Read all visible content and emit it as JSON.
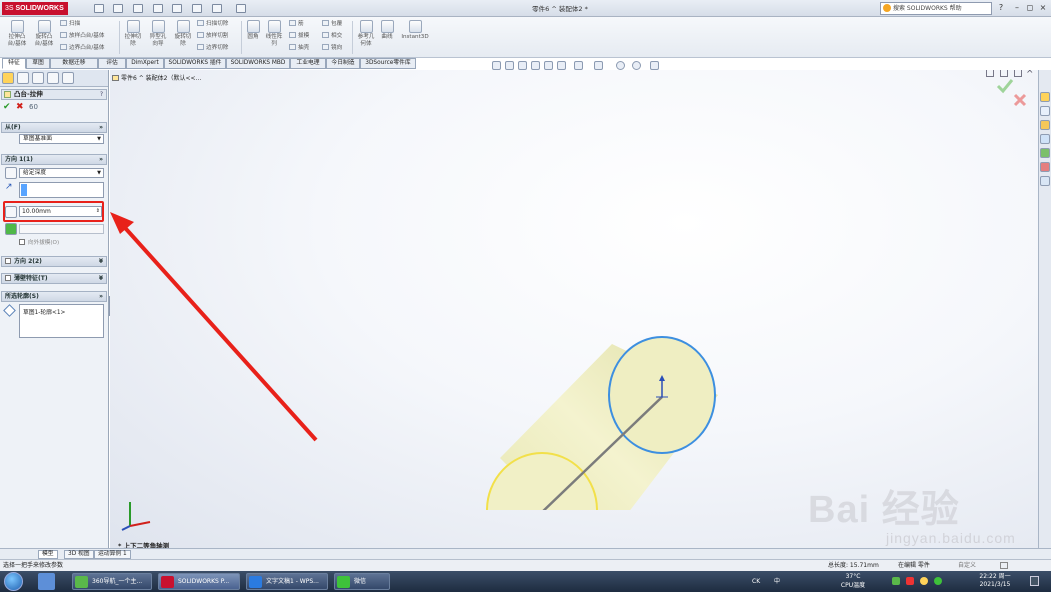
{
  "app": {
    "logo_text": "SOLIDWORKS",
    "logo_prefix": "3S",
    "window_title": "零件6 ^ 装配体2 *",
    "help_search_placeholder": "搜索 SOLIDWORKS 帮助",
    "help_menu": "?",
    "win_minimize": "–",
    "win_restore": "◻",
    "win_close": "×"
  },
  "ribbon": {
    "extrude_boss": "拉伸凸\n台/基体",
    "revolve_boss": "旋转凸\n台/基体",
    "sweep": "扫描",
    "loft": "放样凸台/基体",
    "boundary_boss": "边界凸台/基体",
    "extrude_cut": "拉伸切\n除",
    "hole_wizard": "异型孔\n向导",
    "revolve_cut": "旋转切\n除",
    "swept_cut": "扫描切除",
    "lofted_cut": "放样切割",
    "boundary_cut": "边界切除",
    "fillet": "圆角",
    "linear_pattern": "线性阵\n列",
    "rib": "筋",
    "draft": "拔模",
    "shell": "抽壳",
    "wrap": "包覆",
    "intersect": "相交",
    "mirror": "镜向",
    "ref_geometry": "参考几\n何体",
    "curves": "曲线",
    "instant3d": "Instant3D"
  },
  "command_tabs": [
    "特征",
    "草图",
    "数据迁移",
    "评估",
    "DimXpert",
    "SOLIDWORKS 插件",
    "SOLIDWORKS MBD",
    "工业电理",
    "今日制造",
    "3DSource零件库"
  ],
  "panel": {
    "title": "凸台-拉伸",
    "help": "?",
    "ok": "✔",
    "cancel": "✖",
    "preview": "60",
    "from": {
      "header": "从(F)",
      "value": "草图基准面"
    },
    "direction1": {
      "header": "方向 1(1)",
      "end_condition": "给定深度",
      "depth": "10.00mm",
      "draft_outward": "向外拔模(O)"
    },
    "direction2": {
      "header": "方向 2(2)"
    },
    "thin_feature": {
      "header": "薄壁特征(T)"
    },
    "selected_contours": {
      "header": "所选轮廓(S)",
      "item": "草图1-轮廓<1>"
    }
  },
  "graphics": {
    "tree_path": "零件6 ^ 装配体2（默认<<...",
    "view_label": "* 上下二等角轴测"
  },
  "model_tabs": [
    "模型",
    "3D 视图",
    "运动算例 1"
  ],
  "status": {
    "message": "选择一把手来修改参数",
    "total_length": "总长度: 15.71mm",
    "mode": "在编辑 零件",
    "custom": "自定义"
  },
  "taskbar": {
    "tasks": [
      "360导航_一个主...",
      "SOLIDWORKS P...",
      "文字文稿1 - WPS...",
      "微信"
    ],
    "tray_lang": "CK",
    "tray_ime": "中",
    "temp": "37°C",
    "temp_label": "CPU温度",
    "time": "22:22 周一",
    "date": "2021/3/15"
  },
  "watermark": {
    "main": "Bai 经验",
    "sub": "jingyan.baidu.com"
  },
  "colors": {
    "highlight_red": "#e8211a",
    "cylinder_fill": "#f0efc0",
    "edge_blue": "#3d8fe0",
    "edge_yellow": "#f2e04a"
  }
}
